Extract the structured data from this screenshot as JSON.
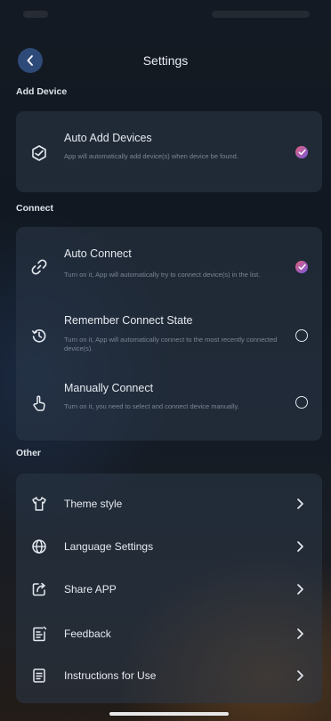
{
  "header": {
    "title": "Settings"
  },
  "sections": {
    "add_device": {
      "label": "Add Device",
      "items": [
        {
          "title": "Auto Add Devices",
          "desc": "App will automatically add device(s) when device be found.",
          "checked": true,
          "icon": "auto-add-icon"
        }
      ]
    },
    "connect": {
      "label": "Connect",
      "items": [
        {
          "title": "Auto Connect",
          "desc": "Turn on it, App will automatically try to connect device(s) in the list.",
          "checked": true,
          "icon": "link-icon"
        },
        {
          "title": "Remember Connect State",
          "desc": "Turn on it, App will automatically connect to the most recently connected device(s).",
          "checked": false,
          "icon": "history-icon"
        },
        {
          "title": "Manually Connect",
          "desc": "Turn on it, you need to select and connect device manually.",
          "checked": false,
          "icon": "hand-tap-icon"
        }
      ]
    },
    "other": {
      "label": "Other",
      "items": [
        {
          "title": "Theme style",
          "icon": "shirt-icon"
        },
        {
          "title": "Language Settings",
          "icon": "globe-icon"
        },
        {
          "title": "Share APP",
          "icon": "share-icon"
        },
        {
          "title": "Feedback",
          "icon": "feedback-icon"
        },
        {
          "title": "Instructions for Use",
          "icon": "document-icon"
        }
      ]
    }
  },
  "colors": {
    "accent_gradient_start": "#e0607a",
    "accent_gradient_end": "#7a5adf",
    "back_button": "#2e4a78",
    "card": "#2c3848"
  }
}
